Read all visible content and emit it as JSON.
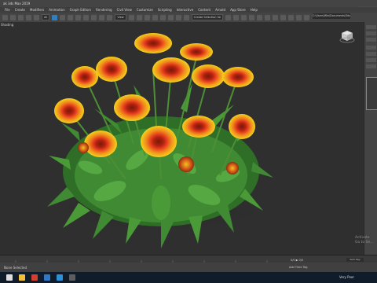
{
  "titlebar": {
    "title": "ak 3ds Max 2019"
  },
  "menu": [
    "File",
    "Create",
    "Modifiers",
    "Animation",
    "Graph Editors",
    "Rendering",
    "Civil View",
    "Customize",
    "Scripting",
    "Interactive",
    "Content",
    "Arnold",
    "App Store",
    "Help"
  ],
  "toolbar": {
    "selection_filter": "All",
    "view_dropdown": "View",
    "named_selection": "Create Selection Se"
  },
  "user": {
    "signin_label": "Sign In"
  },
  "project_path": "C:\\Users\\Win\\Documents\\3ds Max 2019",
  "viewport": {
    "label": "Shading"
  },
  "status": {
    "selection_text": "None Selected",
    "add_time_tag": "Add Time Tag",
    "frame_counter": "0/0 ▶ 0/0",
    "auto_key": "Auto Key",
    "set_key": "Set Key",
    "activate_line1": "Activate",
    "activate_line2": "Go to Se..."
  },
  "taskbar": {
    "weather": "Very Poor"
  },
  "colors": {
    "viewport_bg": "#2f2f2f",
    "petal": "#f4d21c",
    "petal_inner": "#e53b1e",
    "leaf": "#3f8a32"
  }
}
